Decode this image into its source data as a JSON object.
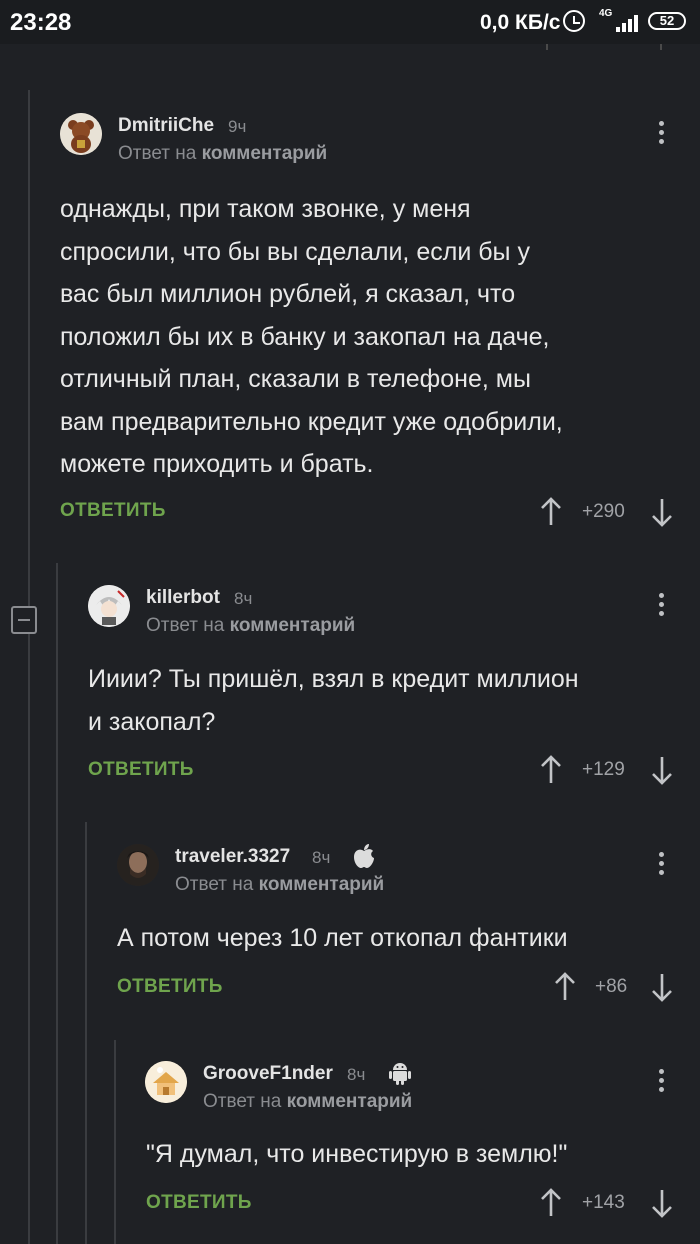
{
  "status_bar": {
    "time": "23:28",
    "network_speed": "0,0 КБ/с",
    "network_type": "4G",
    "battery": "52"
  },
  "comments": [
    {
      "username": "DmitriiChe",
      "time": "9ч",
      "reply_prefix": "Ответ на",
      "reply_target": "комментарий",
      "text": "однажды, при таком звонке, у меня\nспросили, что бы вы сделали, если бы у\nвас был миллион рублей, я сказал, что\nположил бы их в банку и закопал на даче,\nотличный план, сказали в телефоне, мы\nвам предварительно кредит уже одобрили,\nможете приходить и брать.",
      "reply_label": "ОТВЕТИТЬ",
      "score": "+290",
      "avatar_icon": "teddy-bear-avatar"
    },
    {
      "username": "killerbot",
      "time": "8ч",
      "reply_prefix": "Ответ на",
      "reply_target": "комментарий",
      "text": "Ииии? Ты пришёл, взял в кредит миллион\nи закопал?",
      "reply_label": "ОТВЕТИТЬ",
      "score": "+129",
      "avatar_icon": "anime-character-avatar"
    },
    {
      "username": "traveler.3327",
      "time": "8ч",
      "reply_prefix": "Ответ на",
      "reply_target": "комментарий",
      "text": "А потом через 10 лет откопал фантики",
      "reply_label": "ОТВЕТИТЬ",
      "score": "+86",
      "avatar_icon": "man-portrait-avatar",
      "platform_icon": "apple-icon"
    },
    {
      "username": "GrooveF1nder",
      "time": "8ч",
      "reply_prefix": "Ответ на",
      "reply_target": "комментарий",
      "text": "\"Я думал, что инвестирую в землю!\"",
      "reply_label": "ОТВЕТИТЬ",
      "score": "+143",
      "avatar_icon": "cartoon-house-avatar",
      "platform_icon": "android-icon"
    }
  ],
  "colors": {
    "background": "#1f2125",
    "reply_green": "#6fa44d",
    "muted": "#8a8c90"
  }
}
